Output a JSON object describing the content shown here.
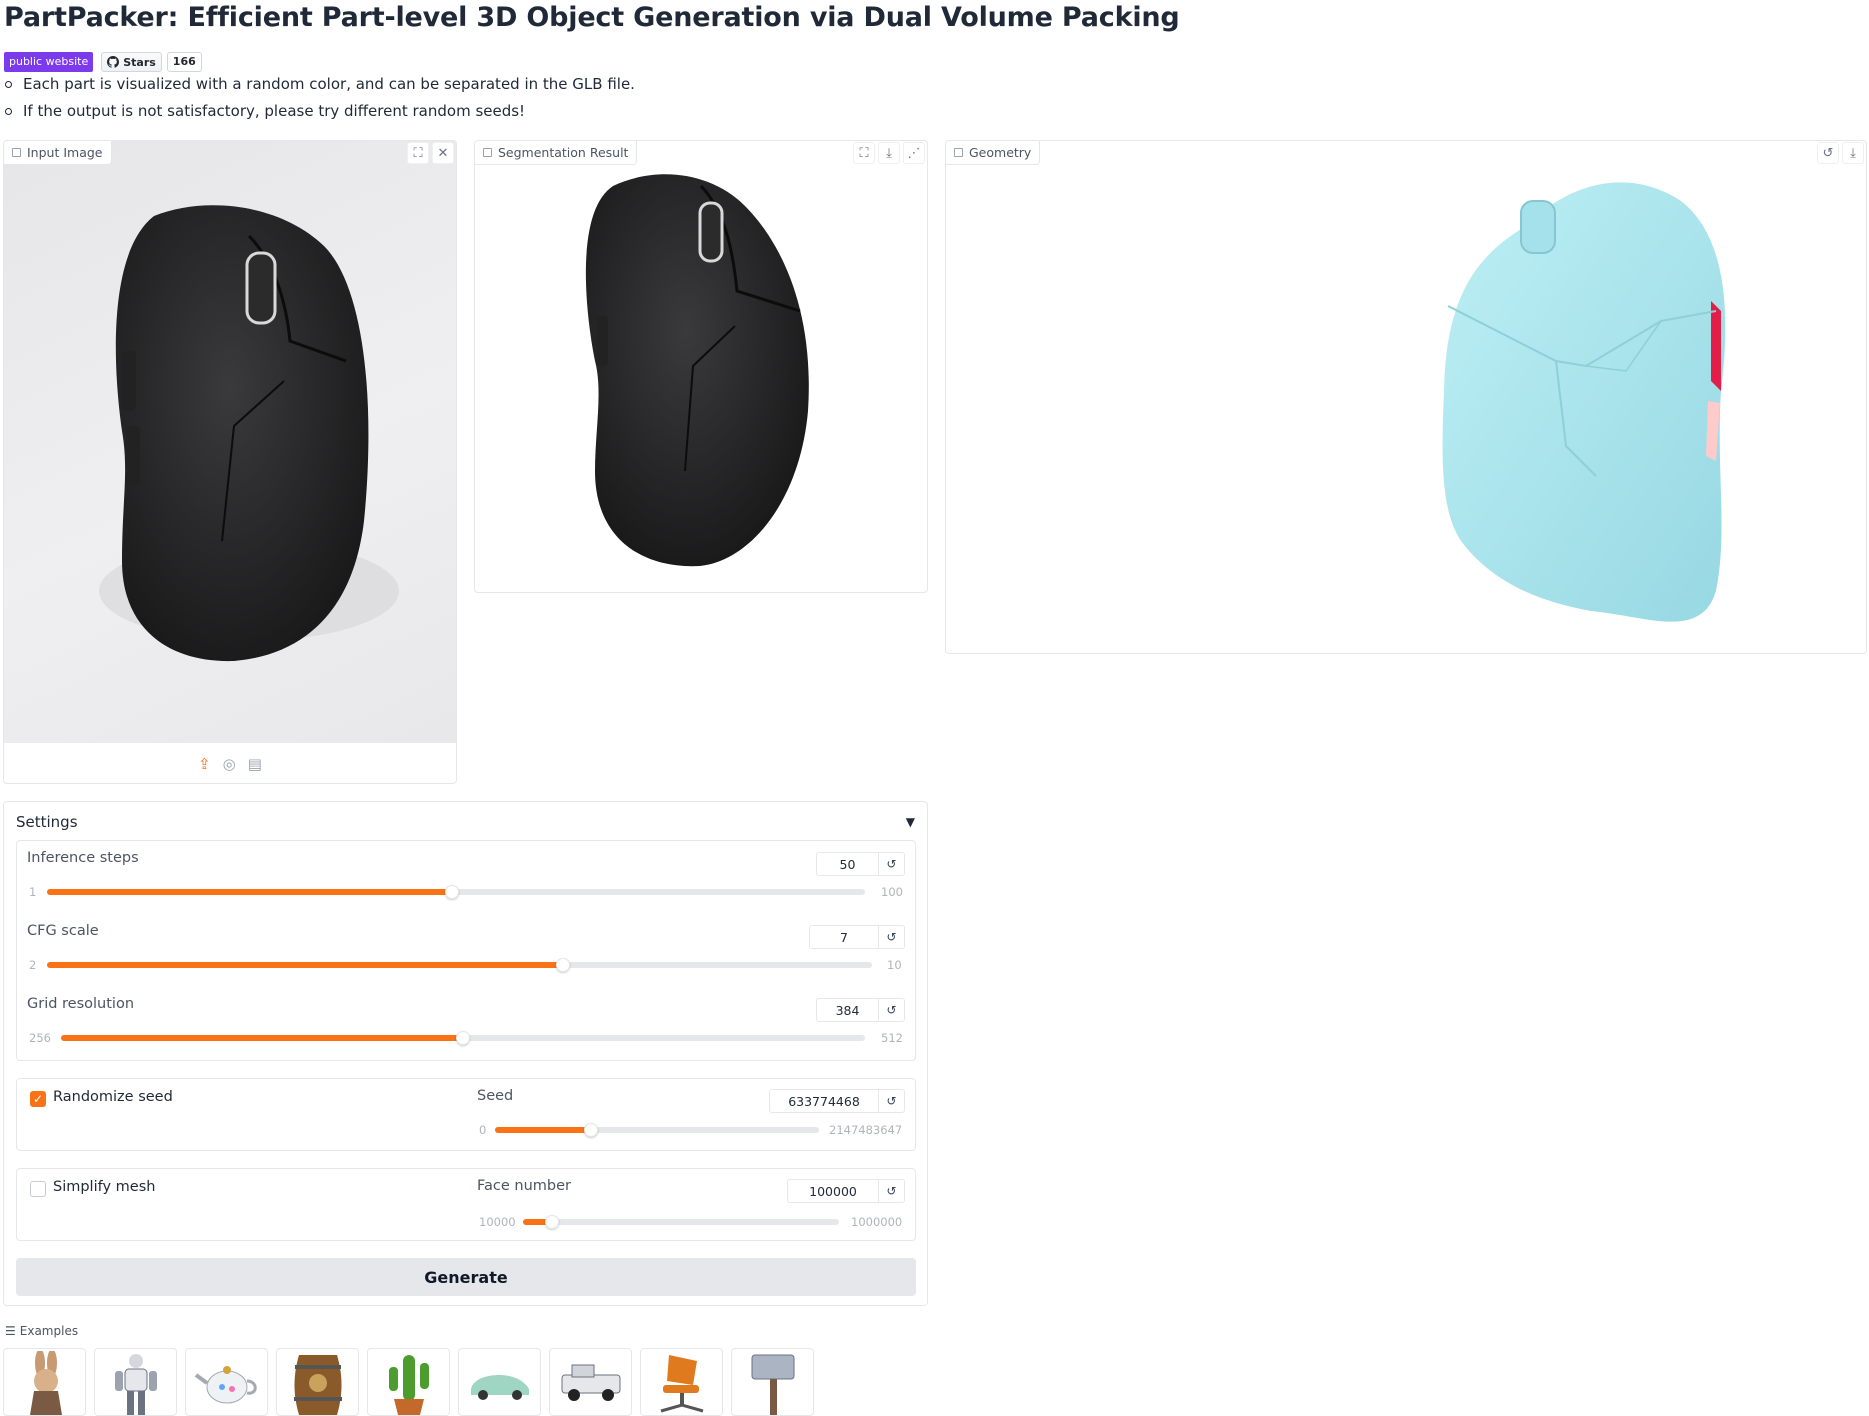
{
  "title": "PartPacker: Efficient Part-level 3D Object Generation via Dual Volume Packing",
  "badges": {
    "website": "public website",
    "stars_label": "Stars",
    "stars_count": "166"
  },
  "bullets": [
    "Each part is visualized with a random color, and can be separated in the GLB file.",
    "If the output is not satisfactory, please try different random seeds!"
  ],
  "panels": {
    "input_image": "Input Image",
    "segmentation": "Segmentation Result",
    "geometry": "Geometry"
  },
  "settings": {
    "title": "Settings",
    "inference_steps": {
      "label": "Inference steps",
      "value": "50",
      "min": "1",
      "max": "100",
      "fraction": 0.495
    },
    "cfg_scale": {
      "label": "CFG scale",
      "value": "7",
      "min": "2",
      "max": "10",
      "fraction": 0.625
    },
    "grid_resolution": {
      "label": "Grid resolution",
      "value": "384",
      "min": "256",
      "max": "512",
      "fraction": 0.5
    },
    "randomize_seed": {
      "label": "Randomize seed",
      "checked": true
    },
    "seed": {
      "label": "Seed",
      "value": "633774468",
      "min": "0",
      "max": "2147483647",
      "fraction": 0.295
    },
    "simplify_mesh": {
      "label": "Simplify mesh",
      "checked": false
    },
    "face_number": {
      "label": "Face number",
      "value": "100000",
      "min": "10000",
      "max": "1000000",
      "fraction": 0.091
    }
  },
  "generate_label": "Generate",
  "examples_label": "Examples",
  "examples": [
    "rabbit",
    "robot",
    "teapot",
    "barrel",
    "cactus",
    "car",
    "truck",
    "office-chair",
    "hammer"
  ],
  "colors": {
    "accent": "#f97316",
    "badge": "#7c3aed",
    "mesh": "#aee7ef"
  }
}
